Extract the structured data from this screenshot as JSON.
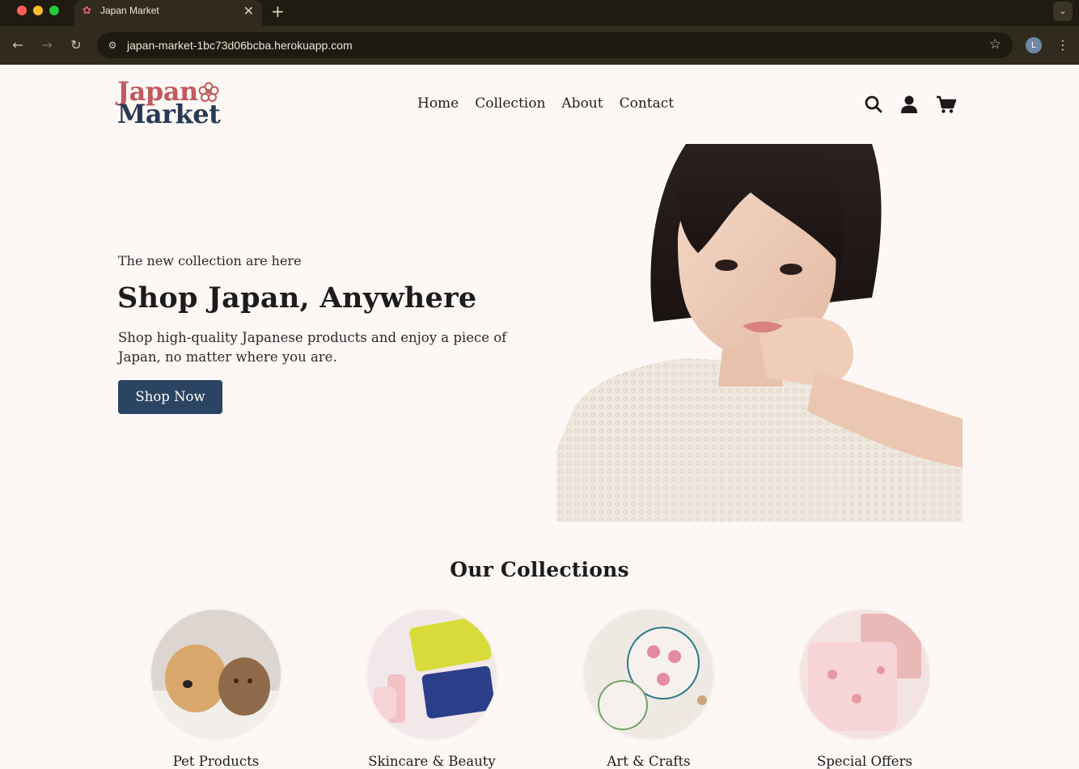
{
  "browser": {
    "tab_title": "Japan Market",
    "tab_close": "✕",
    "new_tab": "+",
    "url": "japan-market-1bc73d06bcba.herokuapp.com",
    "profile_initial": "L",
    "back": "←",
    "forward": "→",
    "reload": "↻",
    "menu": "⋮",
    "tab_search": "⌄",
    "star": "☆"
  },
  "header": {
    "logo_line1": "Japan",
    "logo_line2": "Market",
    "nav": [
      "Home",
      "Collection",
      "About",
      "Contact"
    ],
    "icons": [
      "search-icon",
      "user-icon",
      "cart-icon"
    ]
  },
  "hero": {
    "eyebrow": "The new collection are here",
    "title": "Shop Japan, Anywhere",
    "description": "Shop high-quality Japanese products and enjoy a piece of Japan, no matter where you are.",
    "cta": "Shop Now"
  },
  "collections": {
    "title": "Our Collections",
    "items": [
      {
        "label": "Pet Products"
      },
      {
        "label": "Skincare & Beauty"
      },
      {
        "label": "Art & Crafts"
      },
      {
        "label": "Special Offers"
      }
    ]
  },
  "colors": {
    "brand_red": "#c15a5e",
    "brand_navy": "#273a55",
    "button": "#2c4463",
    "page_bg": "#fdf8f5"
  }
}
